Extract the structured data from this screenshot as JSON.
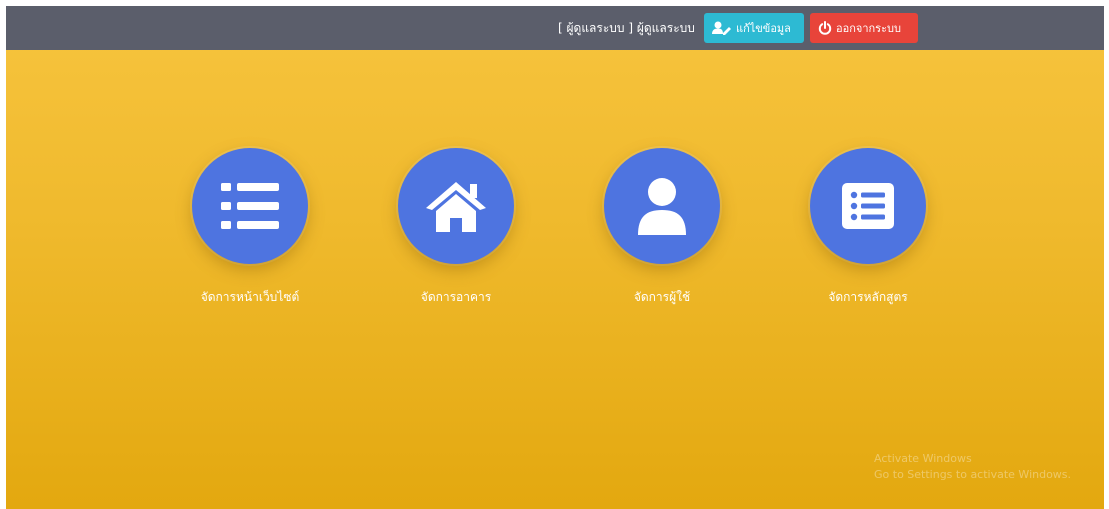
{
  "header": {
    "user_label": "[ ผู้ดูแลระบบ ] ผู้ดูแลระบบ",
    "edit_button_label": "แก้ไขข้อมูล",
    "logout_button_label": "ออกจากระบบ",
    "edit_icon": "user-edit-icon",
    "logout_icon": "power-icon"
  },
  "menu": [
    {
      "label": "จัดการหน้าเว็บไซต์",
      "icon": "list-icon"
    },
    {
      "label": "จัดการอาคาร",
      "icon": "home-icon"
    },
    {
      "label": "จัดการผู้ใช้",
      "icon": "user-icon"
    },
    {
      "label": "จัดการหลักสูตร",
      "icon": "list-alt-icon"
    }
  ],
  "watermark": {
    "line1": "Activate Windows",
    "line2": "Go to Settings to activate Windows."
  },
  "colors": {
    "topbar": "#5b5e6b",
    "edit_button": "#2dbad3",
    "logout_button": "#e8443a",
    "circle": "#4e74e0",
    "background_top": "#f7c43e",
    "background_bottom": "#e3a80f"
  }
}
